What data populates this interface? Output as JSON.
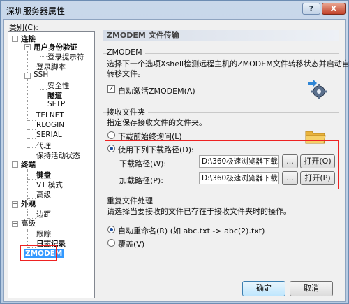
{
  "window": {
    "title": "深圳服务器属性",
    "help_label": "?",
    "close_label": "X"
  },
  "category_label": "类别(C):",
  "tree": {
    "connect": "连接",
    "user_auth": "用户身份验证",
    "login_prompt": "登录提示符",
    "login_script": "登录脚本",
    "ssh": "SSH",
    "security": "安全性",
    "tunnel": "隧道",
    "sftp": "SFTP",
    "telnet": "TELNET",
    "rlogin": "RLOGIN",
    "serial": "SERIAL",
    "proxy": "代理",
    "keepalive": "保持活动状态",
    "terminal": "终端",
    "keyboard": "键盘",
    "vt_mode": "VT 模式",
    "advanced_term": "高级",
    "appearance": "外观",
    "margin": "边距",
    "advanced": "高级",
    "trace": "跟踪",
    "log": "日志记录",
    "zmodem": "ZMODEM"
  },
  "panel": {
    "title": "ZMODEM 文件传输",
    "zmodem_section": "ZMODEM",
    "zmodem_desc_1": "选择下一个选项Xshell检测远程主机的ZMODEM文件转移状态并启动自动",
    "zmodem_desc_2": "转移文件。",
    "auto_activate_label": "自动激活ZMODEM(A)",
    "auto_activate_checked": true,
    "receive_section": "接收文件夹",
    "receive_desc": "指定保存接收文件的文件夹。",
    "ask_before_download": "下载前始终询问(L)",
    "use_following_path": "使用下列下载路径(D):",
    "download_path_label": "下载路径(W):",
    "download_path_value": "D:\\360极速浏览器下载",
    "browse_label": "...",
    "open_o_label": "打开(O)",
    "upload_path_label": "加载路径(P):",
    "upload_path_value": "D:\\360极速浏览器下载",
    "open_p_label": "打开(P)",
    "duplicate_section": "重复文件处理",
    "duplicate_desc": "请选择当要接收的文件已存在于接收文件夹时的操作。",
    "auto_rename": "自动重命名(R) (如 abc.txt -> abc(2).txt)",
    "overwrite": "覆盖(V)"
  },
  "buttons": {
    "ok": "确定",
    "cancel": "取消"
  },
  "colors": {
    "highlight_red": "#e22222",
    "selection": "#3399ff"
  }
}
